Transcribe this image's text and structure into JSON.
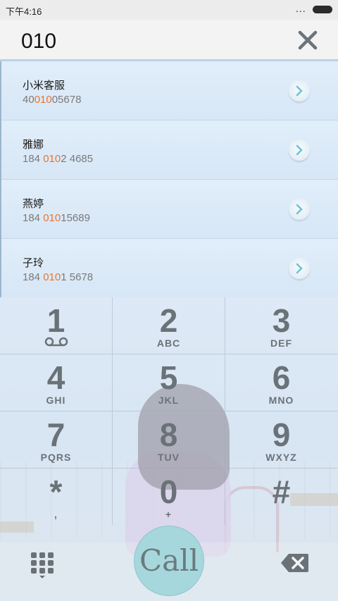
{
  "status_bar": {
    "time": "下午4:16",
    "dots": "..."
  },
  "search": {
    "query": "010"
  },
  "results": [
    {
      "name": "小米客服",
      "number_pre": "40",
      "number_match": "010",
      "number_post": "05678"
    },
    {
      "name": "雅娜",
      "number_pre": "184 ",
      "number_match": "010",
      "number_post": "2 4685"
    },
    {
      "name": "燕婷",
      "number_pre": "184 ",
      "number_match": "010",
      "number_post": "15689"
    },
    {
      "name": "子玲",
      "number_pre": "184 ",
      "number_match": "010",
      "number_post": "1 5678"
    }
  ],
  "dialpad": {
    "keys": [
      {
        "digit": "1",
        "letters": ""
      },
      {
        "digit": "2",
        "letters": "ABC"
      },
      {
        "digit": "3",
        "letters": "DEF"
      },
      {
        "digit": "4",
        "letters": "GHI"
      },
      {
        "digit": "5",
        "letters": "JKL"
      },
      {
        "digit": "6",
        "letters": "MNO"
      },
      {
        "digit": "7",
        "letters": "PQRS"
      },
      {
        "digit": "8",
        "letters": "TUV"
      },
      {
        "digit": "9",
        "letters": "WXYZ"
      },
      {
        "digit": "*",
        "letters": ","
      },
      {
        "digit": "0",
        "letters": "+"
      },
      {
        "digit": "#",
        "letters": ""
      }
    ]
  },
  "bottom_bar": {
    "call_label": "Call"
  },
  "icons": {
    "clear": "close-icon",
    "arrow": "chevron-right-icon",
    "voicemail": "voicemail-icon",
    "keypad": "keypad-grid-icon",
    "delete": "backspace-icon"
  },
  "colors": {
    "match_highlight": "#e8752d",
    "call_button": "#a6d7dc",
    "accent_border": "#b9d3e6"
  }
}
